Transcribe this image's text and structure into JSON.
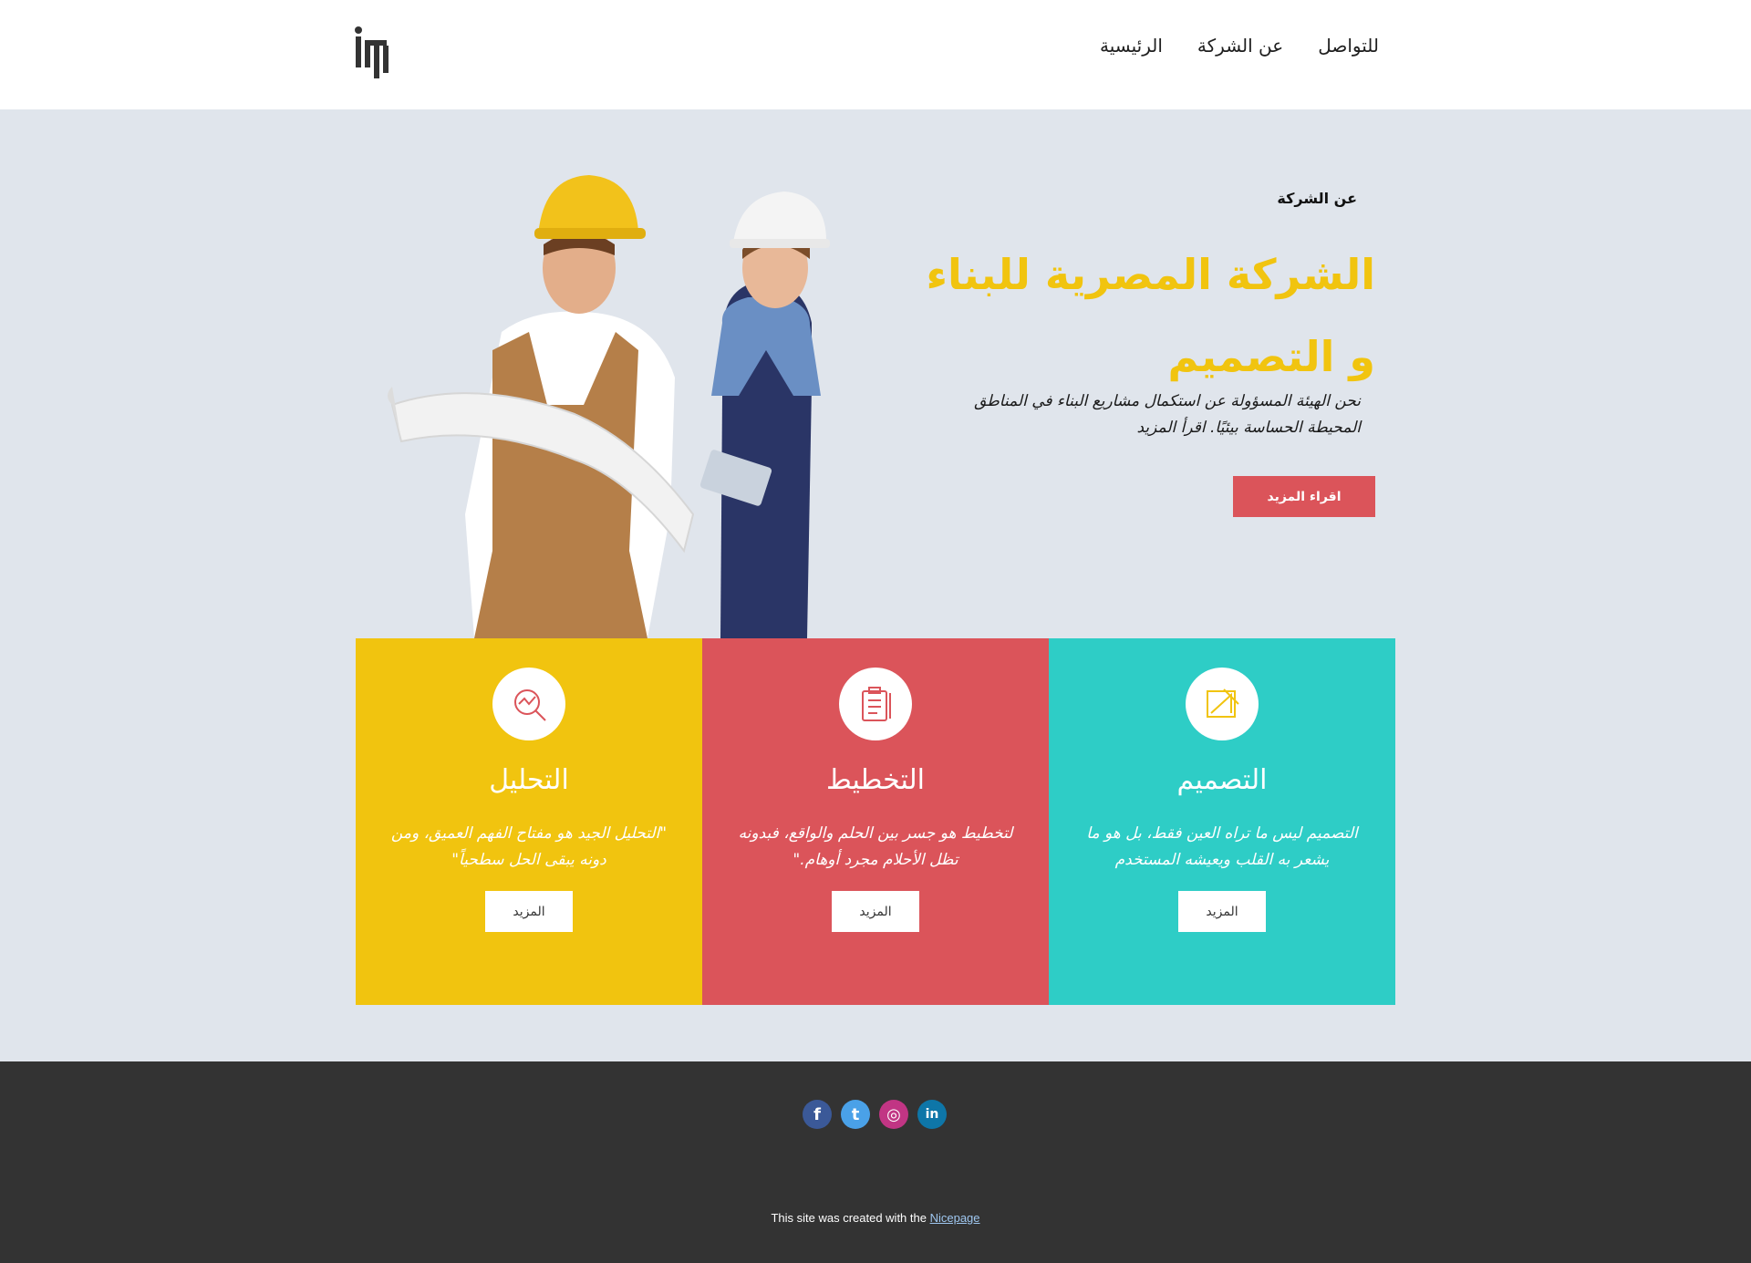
{
  "header": {
    "nav": [
      {
        "label": "الرئيسية"
      },
      {
        "label": "عن الشركة"
      },
      {
        "label": "للتواصل"
      }
    ]
  },
  "hero": {
    "eyebrow": "عن الشركة",
    "title": "الشركة المصرية للبناء و التصميم",
    "text": "نحن الهيئة المسؤولة عن استكمال مشاريع البناء في المناطق المحيطة الحساسة بيئيًا. اقرأ المزيد",
    "button": "اقراء المزيد"
  },
  "cards": [
    {
      "title": "التحليل",
      "text": "\"التحليل الجيد هو مفتاح الفهم العميق، ومن دونه يبقى الحل سطحياً\"",
      "button": "المزيد",
      "color": "#f1c40f",
      "icon": "analysis-icon"
    },
    {
      "title": "التخطيط",
      "text": "لتخطيط هو جسر بين الحلم والواقع، فبدونه تظل الأحلام مجرد أوهام.\"",
      "button": "المزيد",
      "color": "#db545a",
      "icon": "clipboard-icon"
    },
    {
      "title": "التصميم",
      "text": "التصميم ليس ما تراه العين فقط، بل هو ما يشعر به القلب ويعيشه المستخدم",
      "button": "المزيد",
      "color": "#2ecdc6",
      "icon": "design-icon"
    }
  ],
  "footer": {
    "credit_prefix": "This site was created with the ",
    "credit_link": "Nicepage",
    "social": [
      "facebook-icon",
      "twitter-icon",
      "instagram-icon",
      "linkedin-icon"
    ]
  }
}
